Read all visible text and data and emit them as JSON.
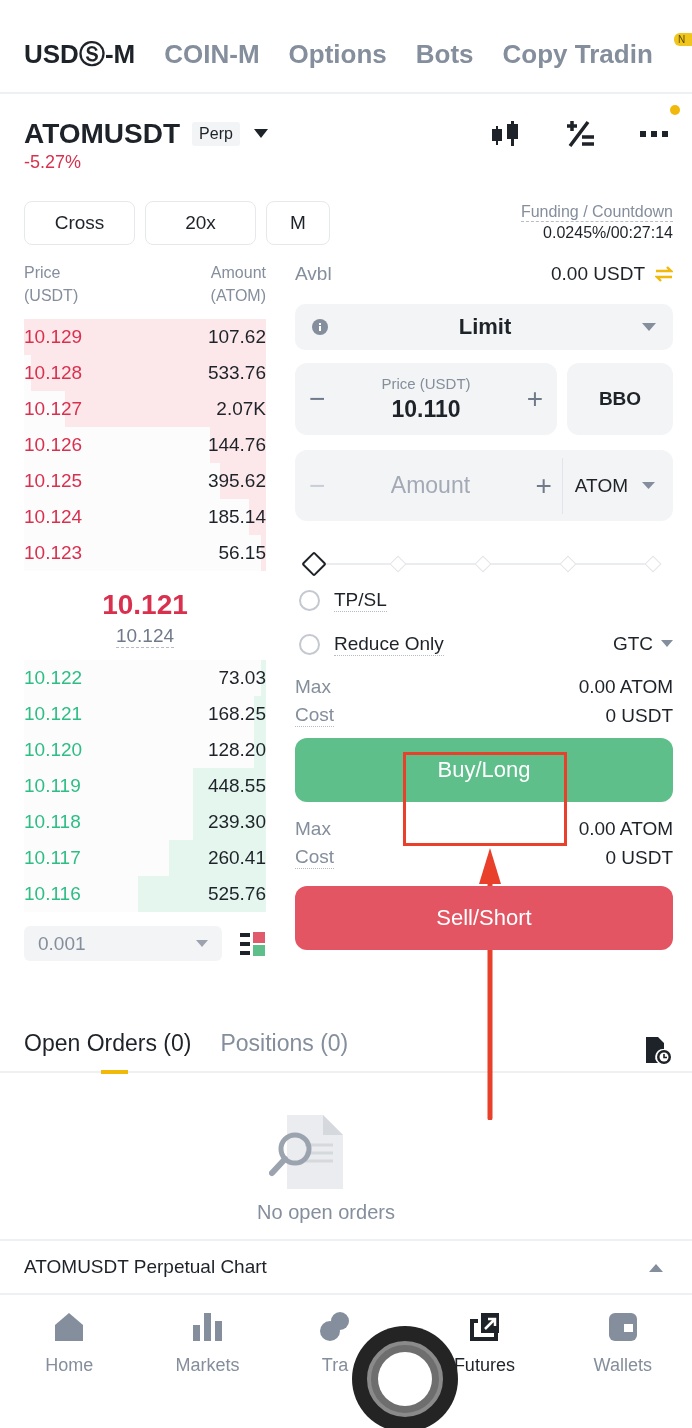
{
  "top_tabs": [
    {
      "label": "USDⓈ-M",
      "selected": true
    },
    {
      "label": "COIN-M",
      "selected": false
    },
    {
      "label": "Options",
      "selected": false
    },
    {
      "label": "Bots",
      "selected": false
    },
    {
      "label": "Copy Tradin",
      "selected": false
    }
  ],
  "tabs_badge": "N",
  "symbol": {
    "name": "ATOMUSDT",
    "tag": "Perp",
    "change": "-5.27%"
  },
  "mode_buttons": [
    "Cross",
    "20x",
    "M"
  ],
  "funding": {
    "label": "Funding / Countdown",
    "value": "0.0245%/00:27:14"
  },
  "order_book": {
    "price_header": [
      "Price",
      "(USDT)"
    ],
    "amount_header": [
      "Amount",
      "(ATOM)"
    ],
    "asks": [
      {
        "price": "10.129",
        "amount": "107.62",
        "level": 1
      },
      {
        "price": "10.128",
        "amount": "533.76",
        "level": 0.97
      },
      {
        "price": "10.127",
        "amount": "2.07K",
        "level": 0.83
      },
      {
        "price": "10.126",
        "amount": "144.76",
        "level": 0.23
      },
      {
        "price": "10.125",
        "amount": "395.62",
        "level": 0.19
      },
      {
        "price": "10.124",
        "amount": "185.14",
        "level": 0.07
      },
      {
        "price": "10.123",
        "amount": "56.15",
        "level": 0.02
      }
    ],
    "last_price": "10.121",
    "mark_price": "10.124",
    "bids": [
      {
        "price": "10.122",
        "amount": "73.03",
        "level": 0.02
      },
      {
        "price": "10.121",
        "amount": "168.25",
        "level": 0.05
      },
      {
        "price": "10.120",
        "amount": "128.20",
        "level": 0.05
      },
      {
        "price": "10.119",
        "amount": "448.55",
        "level": 0.3
      },
      {
        "price": "10.118",
        "amount": "239.30",
        "level": 0.3
      },
      {
        "price": "10.117",
        "amount": "260.41",
        "level": 0.4
      },
      {
        "price": "10.116",
        "amount": "525.76",
        "level": 0.53
      }
    ],
    "tick": "0.001"
  },
  "form": {
    "avbl_label": "Avbl",
    "avbl_value": "0.00 USDT",
    "order_type": "Limit",
    "price_minus": "−",
    "price_label": "Price (USDT)",
    "price_value": "10.110",
    "price_plus": "+",
    "bbo": "BBO",
    "amount_minus": "−",
    "amount_placeholder": "Amount",
    "amount_plus": "+",
    "amount_unit": "ATOM",
    "slider": {
      "level": 0
    },
    "options": [
      {
        "label": "TP/SL",
        "checked": false
      },
      {
        "label": "Reduce Only",
        "checked": false
      }
    ],
    "tif": "GTC",
    "buy_info": [
      {
        "label": "Max",
        "value": "0.00 ATOM"
      },
      {
        "label": "Cost",
        "value": "0 USDT"
      }
    ],
    "buy": "Buy/Long",
    "sell_info": [
      {
        "label": "Max",
        "value": "0.00 ATOM"
      },
      {
        "label": "Cost",
        "value": "0 USDT"
      }
    ],
    "sell": "Sell/Short"
  },
  "order_tabs": [
    {
      "label": "Open Orders (0)",
      "selected": true
    },
    {
      "label": "Positions (0)",
      "selected": false
    }
  ],
  "empty_text": "No open orders",
  "chart_bar": "ATOMUSDT Perpetual  Chart",
  "nav": [
    {
      "label": "Home",
      "selected": false
    },
    {
      "label": "Markets",
      "selected": false
    },
    {
      "label": "Tra",
      "selected": false
    },
    {
      "label": "Futures",
      "selected": true
    },
    {
      "label": "Wallets",
      "selected": false
    }
  ]
}
